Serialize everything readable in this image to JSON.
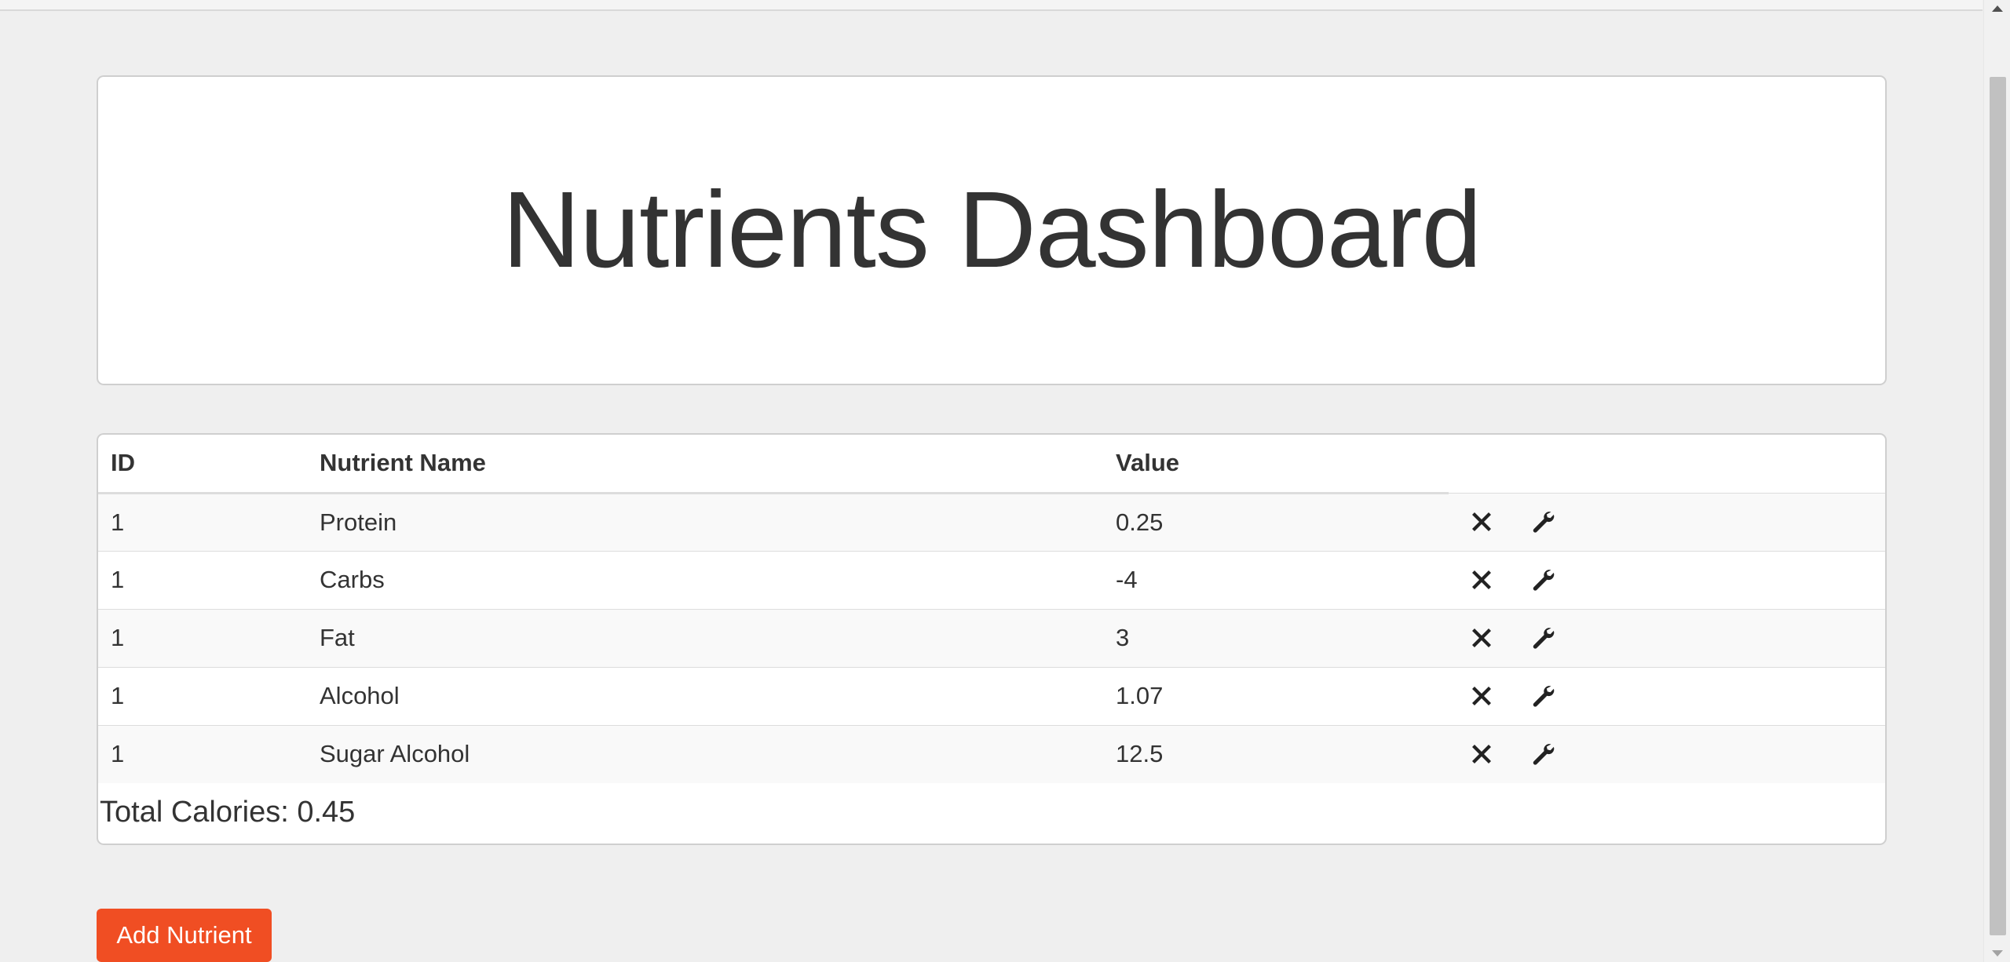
{
  "page": {
    "title": "Nutrients Dashboard"
  },
  "table": {
    "headers": {
      "id": "ID",
      "name": "Nutrient Name",
      "value": "Value"
    },
    "rows": [
      {
        "id": "1",
        "name": "Protein",
        "value": "0.25"
      },
      {
        "id": "1",
        "name": "Carbs",
        "value": "-4"
      },
      {
        "id": "1",
        "name": "Fat",
        "value": "3"
      },
      {
        "id": "1",
        "name": "Alcohol",
        "value": "1.07"
      },
      {
        "id": "1",
        "name": "Sugar Alcohol",
        "value": "12.5"
      }
    ],
    "row_actions": [
      "delete-icon",
      "edit-wrench-icon"
    ]
  },
  "summary": {
    "total_calories": "Total Calories: 0.45"
  },
  "actions": {
    "add_nutrient_label": "Add Nutrient"
  },
  "colors": {
    "accent": "#f04e23",
    "background": "#efefef",
    "card": "#ffffff",
    "text": "#333333"
  }
}
